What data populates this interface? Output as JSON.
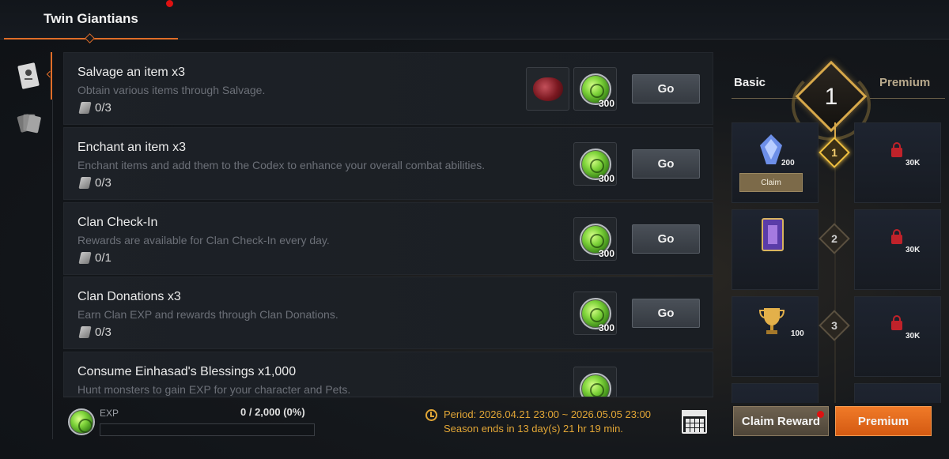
{
  "header": {
    "tab_label": "Twin Giantians"
  },
  "missions": [
    {
      "title": "Salvage an item x3",
      "description": "Obtain various items through Salvage.",
      "progress": "0/3",
      "rewards": [
        {
          "icon": "red-gem-icon",
          "qty": ""
        },
        {
          "icon": "green-coin-icon",
          "qty": "300"
        }
      ],
      "button": "Go"
    },
    {
      "title": "Enchant an item x3",
      "description": "Enchant items and add them to the Codex to enhance your overall combat abilities.",
      "progress": "0/3",
      "rewards": [
        {
          "icon": "green-coin-icon",
          "qty": "300"
        }
      ],
      "button": "Go"
    },
    {
      "title": "Clan Check-In",
      "description": "Rewards are available for Clan Check-In every day.",
      "progress": "0/1",
      "rewards": [
        {
          "icon": "green-coin-icon",
          "qty": "300"
        }
      ],
      "button": "Go"
    },
    {
      "title": "Clan Donations x3",
      "description": "Earn Clan EXP and rewards through Clan Donations.",
      "progress": "0/3",
      "rewards": [
        {
          "icon": "green-coin-icon",
          "qty": "300"
        }
      ],
      "button": "Go"
    },
    {
      "title": "Consume Einhasad's Blessings x1,000",
      "description": "Hunt monsters to gain EXP for your character and Pets.",
      "progress": "",
      "rewards": [
        {
          "icon": "green-coin-icon",
          "qty": ""
        }
      ],
      "button": ""
    }
  ],
  "exp": {
    "label": "EXP",
    "value_text": "0 / 2,000 (0%)",
    "fill_fraction": 0.0
  },
  "period": {
    "line1": "Period: 2026.04.21 23:00 ~ 2026.05.05 23:00",
    "line2": "Season ends in 13 day(s) 21 hr 19 min."
  },
  "pass": {
    "basic_label": "Basic",
    "premium_label": "Premium",
    "level": "1",
    "tiers": [
      {
        "num": "1",
        "basic_qty": "200",
        "basic_icon": "blue-crystal-icon",
        "premium_qty": "30K",
        "claim_label": "Claim",
        "active": true
      },
      {
        "num": "2",
        "basic_qty": "",
        "basic_icon": "purple-card-icon",
        "premium_qty": "30K",
        "active": false
      },
      {
        "num": "3",
        "basic_qty": "100",
        "basic_icon": "gold-trophy-icon",
        "premium_qty": "30K",
        "active": false
      }
    ]
  },
  "buttons": {
    "claim_reward": "Claim Reward",
    "premium": "Premium"
  },
  "colors": {
    "accent_orange": "#e06d28",
    "gold": "#d7a84a",
    "period_text": "#e2a636",
    "lock_red": "#c0222a"
  }
}
